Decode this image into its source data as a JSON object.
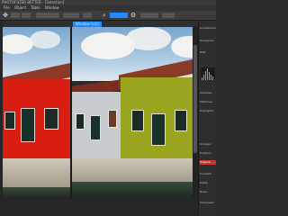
{
  "window": {
    "title": "PHOTOFILTER BETTER - [Selection]"
  },
  "menu": {
    "items": [
      "File",
      "Object",
      "Table",
      "Window"
    ]
  },
  "toolbar": {
    "zoom": "1",
    "accent": "#1e8bff"
  },
  "document": {
    "tab_label": "Window (col)"
  },
  "right_panel": {
    "header": "Adjustments",
    "rows": [
      "Histogram",
      "RGB",
      "",
      "Shadows",
      "Midtones",
      "Highlights"
    ],
    "lower_rows": [
      "Sharpen",
      "Enhance",
      "Contrast",
      "Detail",
      "Noise",
      "Original",
      "Sharpness"
    ]
  },
  "colors": {
    "red_house": "#d81e12",
    "green_house": "#9aa61f",
    "grey_house": "#c8ccd0",
    "sky": "#9ec0dc"
  }
}
